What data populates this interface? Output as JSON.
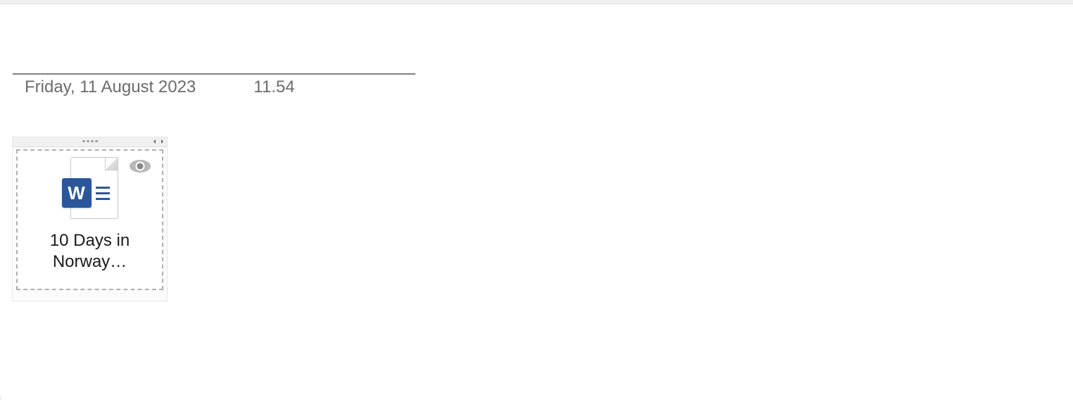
{
  "header": {
    "date": "Friday, 11 August 2023",
    "time": "11.54"
  },
  "attachment": {
    "file_name": "10 Days in Norway…",
    "file_type": "word-document",
    "badge_letter": "W"
  }
}
